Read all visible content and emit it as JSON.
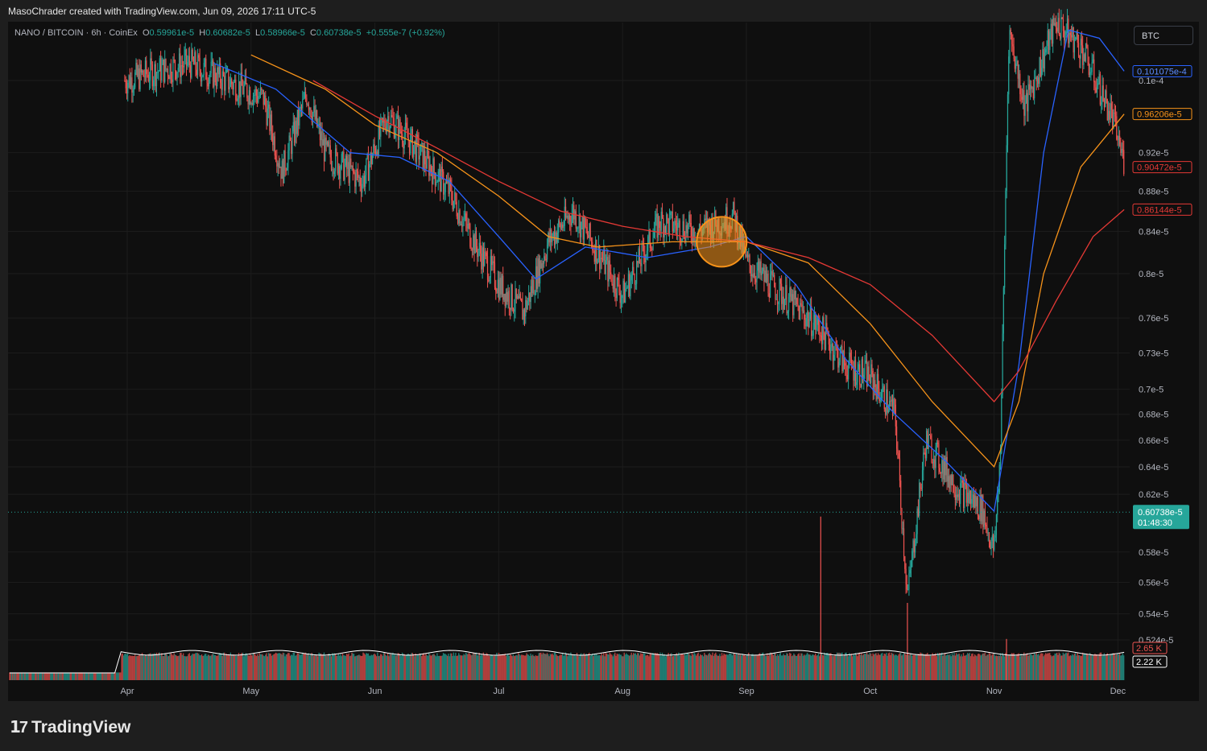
{
  "header": {
    "credit": "MasoChrader created with TradingView.com, Jun 09, 2026 17:11 UTC-5"
  },
  "legend": {
    "symbol": "NANO / BITCOIN · 6h · CoinEx",
    "o_label": "O",
    "o_value": "0.59961e-5",
    "h_label": "H",
    "h_value": "0.60682e-5",
    "l_label": "L",
    "l_value": "0.58966e-5",
    "c_label": "C",
    "c_value": "0.60738e-5",
    "change": "+0.555e-7 (+0.92%)"
  },
  "currency_button": "BTC",
  "brand": {
    "name": "TradingView"
  },
  "colors": {
    "up": "#26a69a",
    "down": "#ef5350",
    "ma_blue": "#2962ff",
    "ma_orange": "#f7931a",
    "ma_red": "#e53935",
    "highlight": "#f7931a"
  },
  "chart_data": {
    "type": "line",
    "title": "NANO / BITCOIN · 6h · CoinEx",
    "scale": "log",
    "y_tick_labels": [
      "0.1e-4",
      "0.92e-5",
      "0.88e-5",
      "0.84e-5",
      "0.8e-5",
      "0.76e-5",
      "0.73e-5",
      "0.7e-5",
      "0.68e-5",
      "0.66e-5",
      "0.64e-5",
      "0.62e-5",
      "0.58e-5",
      "0.56e-5",
      "0.54e-5",
      "0.524e-5"
    ],
    "x_tick_labels": [
      "Apr",
      "May",
      "Jun",
      "Jul",
      "Aug",
      "Sep",
      "Oct",
      "Nov",
      "Dec"
    ],
    "price_axis_ticks": [
      {
        "label": "0.1e-4",
        "value": 1e-05
      },
      {
        "label": "0.92e-5",
        "value": 9.2e-06
      },
      {
        "label": "0.88e-5",
        "value": 8.8e-06
      },
      {
        "label": "0.84e-5",
        "value": 8.4e-06
      },
      {
        "label": "0.8e-5",
        "value": 8e-06
      },
      {
        "label": "0.76e-5",
        "value": 7.6e-06
      },
      {
        "label": "0.73e-5",
        "value": 7.3e-06
      },
      {
        "label": "0.7e-5",
        "value": 7e-06
      },
      {
        "label": "0.68e-5",
        "value": 6.8e-06
      },
      {
        "label": "0.66e-5",
        "value": 6.6e-06
      },
      {
        "label": "0.64e-5",
        "value": 6.4e-06
      },
      {
        "label": "0.62e-5",
        "value": 6.2e-06
      },
      {
        "label": "0.58e-5",
        "value": 5.8e-06
      },
      {
        "label": "0.56e-5",
        "value": 5.6e-06
      },
      {
        "label": "0.54e-5",
        "value": 5.4e-06
      },
      {
        "label": "0.524e-5",
        "value": 5.24e-06
      }
    ],
    "x_ticks": [
      {
        "label": "Apr",
        "t": 0.0
      },
      {
        "label": "May",
        "t": 1.0
      },
      {
        "label": "Jun",
        "t": 2.0
      },
      {
        "label": "Jul",
        "t": 3.0
      },
      {
        "label": "Aug",
        "t": 4.0
      },
      {
        "label": "Sep",
        "t": 5.0
      },
      {
        "label": "Oct",
        "t": 6.0
      },
      {
        "label": "Nov",
        "t": 7.0
      },
      {
        "label": "Dec",
        "t": 8.0
      }
    ],
    "price_keypoints": [
      {
        "t": 0.0,
        "p": 1e-05
      },
      {
        "t": 0.2,
        "p": 1.01e-05
      },
      {
        "t": 0.5,
        "p": 1.02e-05
      },
      {
        "t": 0.8,
        "p": 1e-05
      },
      {
        "t": 1.1,
        "p": 9.8e-06
      },
      {
        "t": 1.25,
        "p": 9e-06
      },
      {
        "t": 1.45,
        "p": 9.85e-06
      },
      {
        "t": 1.6,
        "p": 9.2e-06
      },
      {
        "t": 1.9,
        "p": 8.9e-06
      },
      {
        "t": 2.1,
        "p": 9.6e-06
      },
      {
        "t": 2.3,
        "p": 9.3e-06
      },
      {
        "t": 2.6,
        "p": 8.8e-06
      },
      {
        "t": 2.8,
        "p": 8.3e-06
      },
      {
        "t": 3.0,
        "p": 7.9e-06
      },
      {
        "t": 3.2,
        "p": 7.65e-06
      },
      {
        "t": 3.4,
        "p": 8.3e-06
      },
      {
        "t": 3.6,
        "p": 8.6e-06
      },
      {
        "t": 3.8,
        "p": 8.2e-06
      },
      {
        "t": 4.0,
        "p": 7.8e-06
      },
      {
        "t": 4.3,
        "p": 8.5e-06
      },
      {
        "t": 4.6,
        "p": 8.4e-06
      },
      {
        "t": 4.9,
        "p": 8.55e-06
      },
      {
        "t": 5.0,
        "p": 8.1e-06
      },
      {
        "t": 5.3,
        "p": 7.8e-06
      },
      {
        "t": 5.6,
        "p": 7.5e-06
      },
      {
        "t": 5.8,
        "p": 7.2e-06
      },
      {
        "t": 6.0,
        "p": 7.1e-06
      },
      {
        "t": 6.2,
        "p": 6.8e-06
      },
      {
        "t": 6.3,
        "p": 5.5e-06
      },
      {
        "t": 6.45,
        "p": 6.6e-06
      },
      {
        "t": 6.7,
        "p": 6.25e-06
      },
      {
        "t": 6.9,
        "p": 6.1e-06
      },
      {
        "t": 7.0,
        "p": 5.8e-06
      },
      {
        "t": 7.05,
        "p": 6.5e-06
      },
      {
        "t": 7.12,
        "p": 1.06e-05
      },
      {
        "t": 7.25,
        "p": 9.7e-06
      },
      {
        "t": 7.5,
        "p": 1.07e-05
      },
      {
        "t": 7.7,
        "p": 1.04e-05
      },
      {
        "t": 7.95,
        "p": 9.6e-06
      },
      {
        "t": 8.05,
        "p": 9.1e-06
      }
    ],
    "series": [
      {
        "name": "",
        "values": [
          {
            "t": 0.7,
            "p": 1.02e-05
          },
          {
            "t": 1.2,
            "p": 9.9e-06
          },
          {
            "t": 1.8,
            "p": 9.2e-06
          },
          {
            "t": 2.2,
            "p": 9.15e-06
          },
          {
            "t": 2.6,
            "p": 8.9e-06
          },
          {
            "t": 3.0,
            "p": 8.35e-06
          },
          {
            "t": 3.3,
            "p": 7.95e-06
          },
          {
            "t": 3.7,
            "p": 8.25e-06
          },
          {
            "t": 4.2,
            "p": 8.15e-06
          },
          {
            "t": 4.7,
            "p": 8.25e-06
          },
          {
            "t": 5.0,
            "p": 8.35e-06
          },
          {
            "t": 5.4,
            "p": 7.9e-06
          },
          {
            "t": 5.8,
            "p": 7.25e-06
          },
          {
            "t": 6.2,
            "p": 6.8e-06
          },
          {
            "t": 6.6,
            "p": 6.45e-06
          },
          {
            "t": 7.0,
            "p": 6.08e-06
          },
          {
            "t": 7.2,
            "p": 7.2e-06
          },
          {
            "t": 7.4,
            "p": 9.2e-06
          },
          {
            "t": 7.6,
            "p": 1.06e-05
          },
          {
            "t": 7.85,
            "p": 1.05e-05
          },
          {
            "t": 8.05,
            "p": 1.0108e-05
          }
        ]
      },
      {
        "name": "",
        "values": [
          {
            "t": 1.0,
            "p": 1.03e-05
          },
          {
            "t": 1.6,
            "p": 9.9e-06
          },
          {
            "t": 2.0,
            "p": 9.5e-06
          },
          {
            "t": 2.5,
            "p": 9.2e-06
          },
          {
            "t": 3.0,
            "p": 8.75e-06
          },
          {
            "t": 3.4,
            "p": 8.35e-06
          },
          {
            "t": 3.8,
            "p": 8.25e-06
          },
          {
            "t": 4.4,
            "p": 8.3e-06
          },
          {
            "t": 5.0,
            "p": 8.3e-06
          },
          {
            "t": 5.5,
            "p": 8.1e-06
          },
          {
            "t": 6.0,
            "p": 7.55e-06
          },
          {
            "t": 6.5,
            "p": 6.9e-06
          },
          {
            "t": 7.0,
            "p": 6.4e-06
          },
          {
            "t": 7.2,
            "p": 6.9e-06
          },
          {
            "t": 7.4,
            "p": 8e-06
          },
          {
            "t": 7.7,
            "p": 9.05e-06
          },
          {
            "t": 8.05,
            "p": 9.62e-06
          }
        ]
      },
      {
        "name": "",
        "values": [
          {
            "t": 1.5,
            "p": 1e-05
          },
          {
            "t": 2.0,
            "p": 9.6e-06
          },
          {
            "t": 2.5,
            "p": 9.25e-06
          },
          {
            "t": 3.0,
            "p": 8.9e-06
          },
          {
            "t": 3.5,
            "p": 8.6e-06
          },
          {
            "t": 4.0,
            "p": 8.45e-06
          },
          {
            "t": 4.5,
            "p": 8.35e-06
          },
          {
            "t": 5.0,
            "p": 8.3e-06
          },
          {
            "t": 5.5,
            "p": 8.15e-06
          },
          {
            "t": 6.0,
            "p": 7.9e-06
          },
          {
            "t": 6.5,
            "p": 7.45e-06
          },
          {
            "t": 7.0,
            "p": 6.9e-06
          },
          {
            "t": 7.2,
            "p": 7.15e-06
          },
          {
            "t": 7.5,
            "p": 7.75e-06
          },
          {
            "t": 7.8,
            "p": 8.35e-06
          },
          {
            "t": 8.05,
            "p": 8.614e-06
          }
        ]
      }
    ],
    "price_tags": [
      {
        "label": "0.101075e-4",
        "value": 1.01075e-05,
        "color": "#2962ff"
      },
      {
        "label": "0.96206e-5",
        "value": 9.6206e-06,
        "color": "#f7931a"
      },
      {
        "label": "0.90472e-5",
        "value": 9.0472e-06,
        "color": "#e53935"
      },
      {
        "label": "0.86144e-5",
        "value": 8.6144e-06,
        "color": "#e53935"
      }
    ],
    "last_price": {
      "label": "0.60738e-5",
      "countdown": "01:48:30",
      "value": 6.0738e-06
    },
    "highlight_circle": {
      "t": 4.8,
      "p": 8.3e-06
    },
    "volume": {
      "tags": [
        {
          "label": "2.65 K",
          "color": "#ef5350"
        },
        {
          "label": "2.22 K",
          "color": "#ffffff"
        }
      ],
      "spikes": [
        {
          "t": 5.6,
          "v": 5.0
        },
        {
          "t": 6.3,
          "v": 3.0
        },
        {
          "t": 7.1,
          "v": 1.6
        }
      ]
    }
  }
}
